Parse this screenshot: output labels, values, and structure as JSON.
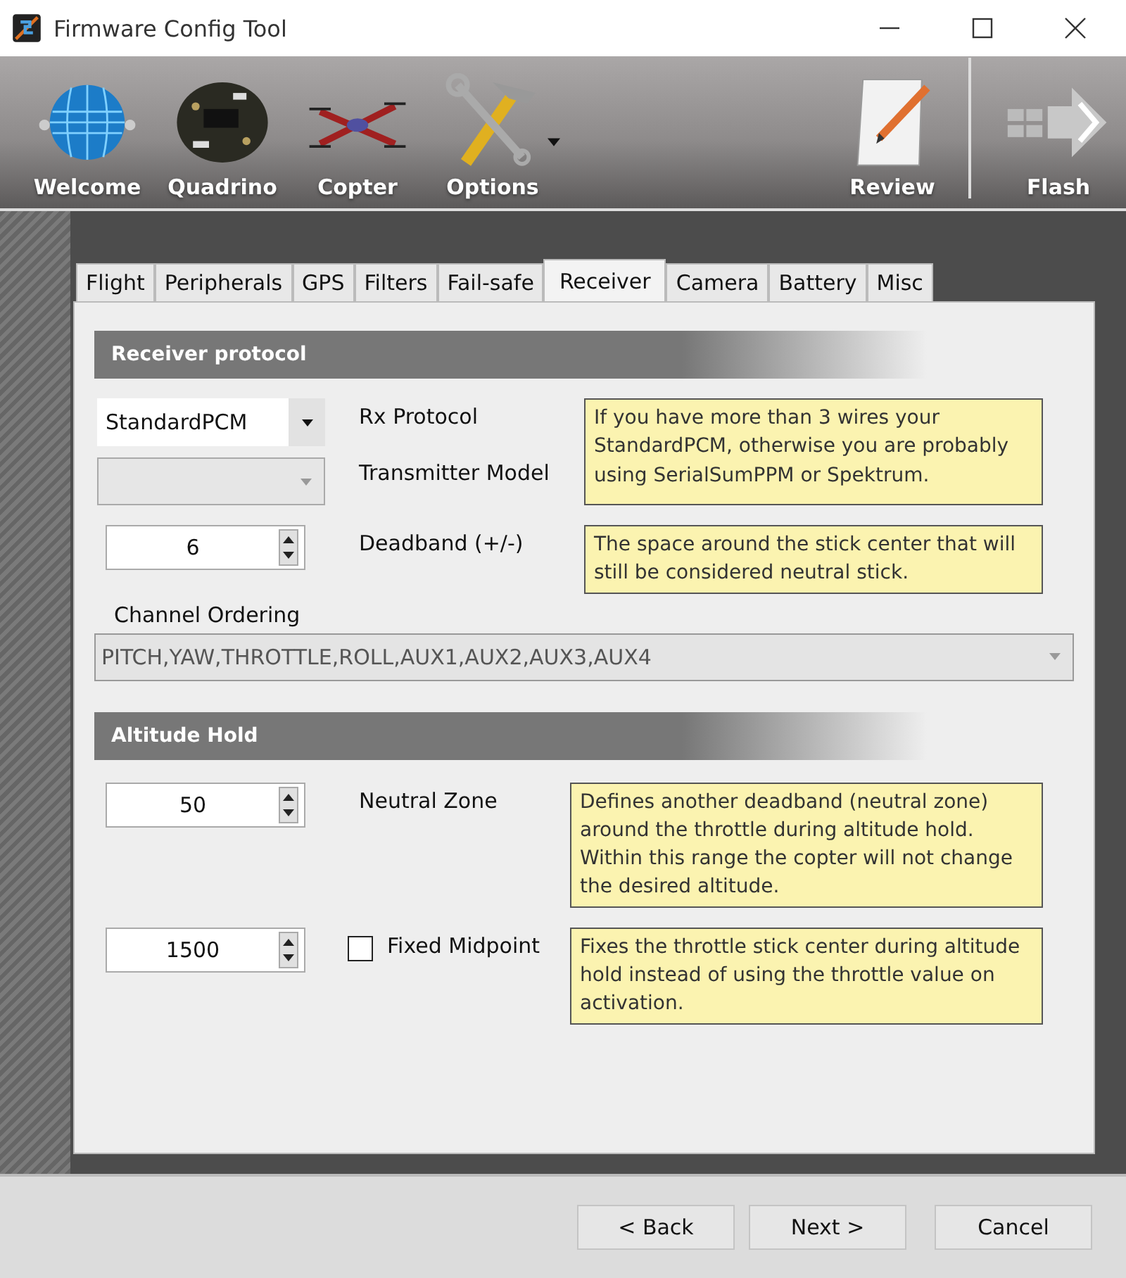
{
  "window": {
    "title": "Firmware Config Tool"
  },
  "toolbar": {
    "items": [
      {
        "label": "Welcome",
        "kind": "globe",
        "menu": false
      },
      {
        "label": "Quadrino",
        "kind": "board",
        "menu": false
      },
      {
        "label": "Copter",
        "kind": "drone",
        "menu": false
      },
      {
        "label": "Options",
        "kind": "tools",
        "menu": true
      }
    ],
    "right_items": [
      {
        "label": "Review",
        "kind": "notepad",
        "menu": false
      },
      {
        "label": "Flash",
        "kind": "chip",
        "menu": false
      }
    ]
  },
  "tabs": [
    {
      "label": "Flight",
      "selected": false
    },
    {
      "label": "Peripherals",
      "selected": false
    },
    {
      "label": "GPS",
      "selected": false
    },
    {
      "label": "Filters",
      "selected": false
    },
    {
      "label": "Fail-safe",
      "selected": false
    },
    {
      "label": "Receiver",
      "selected": true
    },
    {
      "label": "Camera",
      "selected": false
    },
    {
      "label": "Battery",
      "selected": false
    },
    {
      "label": "Misc",
      "selected": false
    }
  ],
  "receiver_protocol": {
    "title": "Receiver protocol",
    "rx_protocol": {
      "value": "StandardPCM",
      "label": "Rx Protocol",
      "disabled": false
    },
    "transmitter_model": {
      "label": "Transmitter Model",
      "disabled": true
    },
    "protocol_help": "If you have more than 3 wires your StandardPCM, otherwise you are probably using SerialSumPPM or Spektrum.",
    "deadband": {
      "value": "6",
      "label": "Deadband (+/-)",
      "help": "The space around the stick center that will still be considered neutral stick."
    },
    "channel_ordering": {
      "label": "Channel Ordering",
      "value": "PITCH,YAW,THROTTLE,ROLL,AUX1,AUX2,AUX3,AUX4",
      "disabled": true
    }
  },
  "altitude_hold": {
    "title": "Altitude Hold",
    "neutral_zone": {
      "value": "50",
      "label": "Neutral Zone",
      "help": "Defines another deadband (neutral zone) around the throttle during altitude hold. Within this range the copter will not change the desired altitude."
    },
    "fixed_midpoint": {
      "value": "1500",
      "label": "Fixed Midpoint",
      "checked": false,
      "help": "Fixes the throttle stick center during altitude hold instead of using the throttle value on activation."
    }
  },
  "buttons": [
    "< Back",
    "Next >",
    "Cancel"
  ]
}
